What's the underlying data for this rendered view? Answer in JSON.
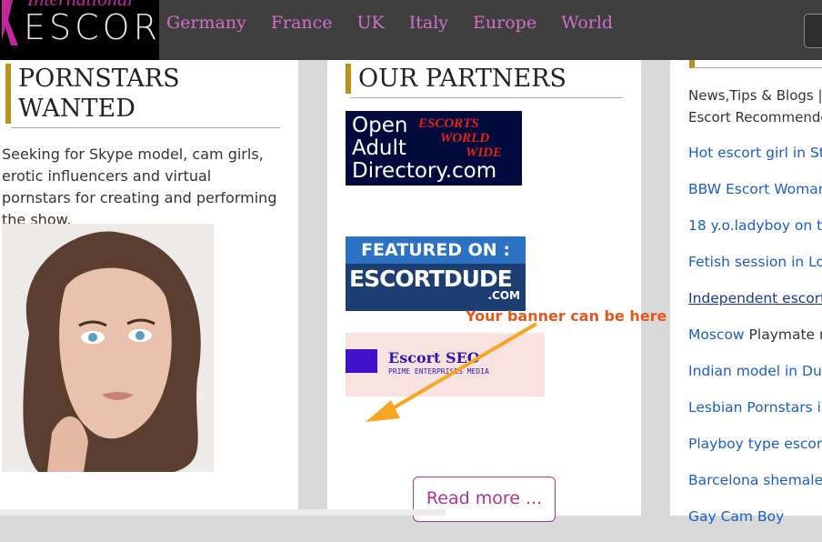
{
  "header": {
    "logo_small": "International",
    "logo_big": "ESCORT",
    "nav": [
      "Germany",
      "France",
      "UK",
      "Italy",
      "Europe",
      "World"
    ]
  },
  "col1": {
    "heading": "PORNSTARS WANTED",
    "intro": "Seeking for  Skype model, cam girls, erotic influencers and virtual pornstars for creating and performing the show."
  },
  "col2": {
    "heading": "OUR PARTNERS",
    "oad_text": [
      "Open",
      "Adult",
      "Directory.com"
    ],
    "oad_red": [
      "ESCORTS",
      "WORLD",
      "WIDE"
    ],
    "ed_featured": "FEATURED ON :",
    "ed_brand": "ESCORTDUDE",
    "ed_com": ".COM",
    "seo_name": "Escort SEO",
    "seo_sub": "PRIME ENTERPRISES MEDIA",
    "callout": "Your banner can be here",
    "read_more": "Read more ..."
  },
  "col3": {
    "intro_line1": "News,Tips & Blogs |",
    "intro_line2": "Escort Recommende",
    "links": [
      {
        "text": "Hot escort girl  in St",
        "extra": ""
      },
      {
        "text": "BBW Escort Woman",
        "extra": ""
      },
      {
        "text": "18 y.o.ladyboy on to",
        "extra": ""
      },
      {
        "text": "Fetish session in Lor",
        "extra": ""
      },
      {
        "text": "Independent escort",
        "extra": ""
      },
      {
        "text": "Moscow",
        "extra": " Playmate n"
      },
      {
        "text": "Indian model in Dub",
        "extra": ""
      },
      {
        "text": "Lesbian Pornstars in",
        "extra": ""
      },
      {
        "text": "Playboy type escort",
        "extra": ""
      },
      {
        "text": "Barcelona shemale",
        "extra": ""
      },
      {
        "text": "Gay Cam Boy",
        "extra": ""
      }
    ]
  },
  "colors": {
    "nav_link": "#d36fc8",
    "accent_bar": "#b8941f",
    "link_blue": "#1a5ec9",
    "callout_orange": "#e4571a",
    "button_border": "#b2338c"
  }
}
